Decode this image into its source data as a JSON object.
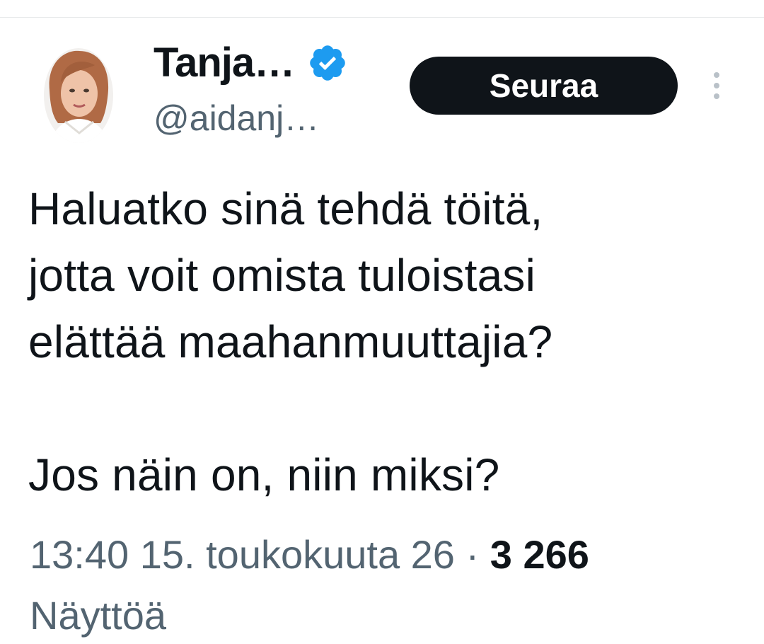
{
  "tweet": {
    "author": {
      "display_name": "Tanja…",
      "handle": "@aidanj…",
      "verified": true,
      "verified_color": "#1d9bf0"
    },
    "follow_button": {
      "label": "Seuraa",
      "background": "#0f1419",
      "text_color": "#ffffff"
    },
    "more_icon": "more-vertical-icon",
    "text_lines": [
      "Haluatko sinä tehdä töitä,",
      "jotta voit omista tuloistasi",
      "elättää maahanmuuttajia?",
      "Jos näin on, niin miksi?"
    ],
    "meta": {
      "time": "13:40",
      "date": "15. toukokuuta 26",
      "separator": "·",
      "views_count": "3 266",
      "views_label": "Näyttöä"
    }
  }
}
